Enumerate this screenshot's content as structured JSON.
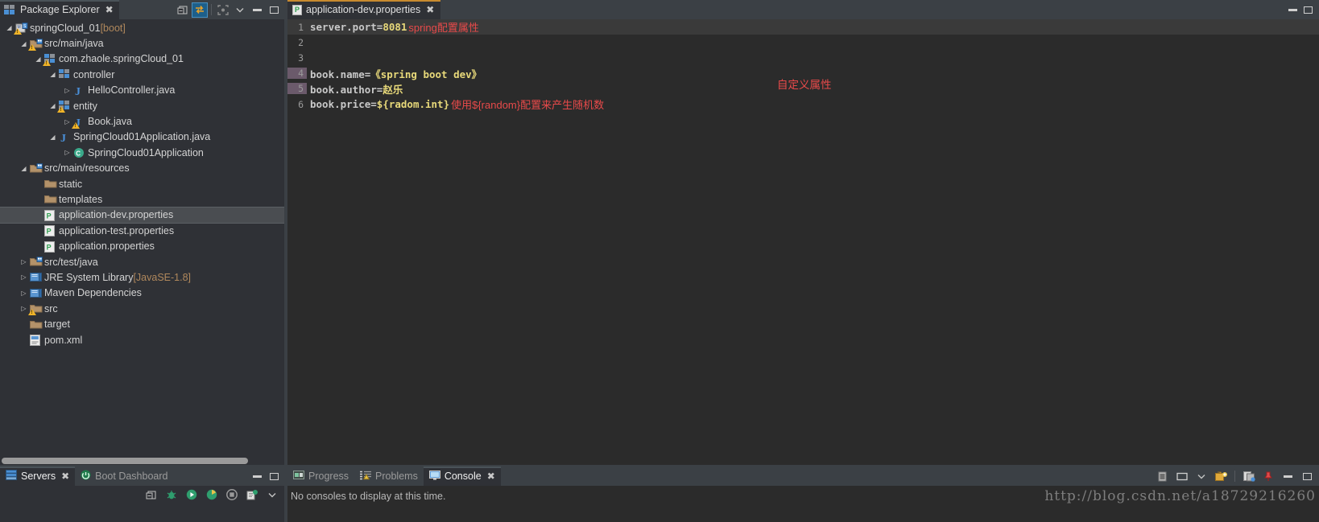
{
  "explorer": {
    "tab_title": "Package Explorer",
    "close_glyph": "✖",
    "toolbar": [
      {
        "name": "collapse-all-icon",
        "glyph": "▣"
      },
      {
        "name": "link-with-editor-icon",
        "glyph": "⇄"
      },
      {
        "name": "focus-on-active-task-icon",
        "glyph": "⛶"
      },
      {
        "name": "view-menu-icon",
        "glyph": "⌄"
      },
      {
        "name": "minimize-icon",
        "glyph": "▬"
      },
      {
        "name": "maximize-icon",
        "glyph": "▭"
      }
    ],
    "tree": [
      {
        "label": "springCloud_01",
        "suffix": " [boot]",
        "indent": 0,
        "arrow": "down",
        "icon": "project",
        "warn": true
      },
      {
        "label": "src/main/java",
        "suffix": "",
        "indent": 1,
        "arrow": "down",
        "icon": "srcfolder",
        "warn": true
      },
      {
        "label": "com.zhaole.springCloud_01",
        "suffix": "",
        "indent": 2,
        "arrow": "down",
        "icon": "package",
        "warn": true
      },
      {
        "label": "controller",
        "suffix": "",
        "indent": 3,
        "arrow": "down",
        "icon": "package",
        "warn": false
      },
      {
        "label": "HelloController.java",
        "suffix": "",
        "indent": 4,
        "arrow": "right",
        "icon": "java",
        "warn": false
      },
      {
        "label": "entity",
        "suffix": "",
        "indent": 3,
        "arrow": "down",
        "icon": "package",
        "warn": true
      },
      {
        "label": "Book.java",
        "suffix": "",
        "indent": 4,
        "arrow": "right",
        "icon": "java",
        "warn": true
      },
      {
        "label": "SpringCloud01Application.java",
        "suffix": "",
        "indent": 3,
        "arrow": "down",
        "icon": "java",
        "warn": false
      },
      {
        "label": "SpringCloud01Application",
        "suffix": "",
        "indent": 4,
        "arrow": "right",
        "icon": "class",
        "warn": false
      },
      {
        "label": "src/main/resources",
        "suffix": "",
        "indent": 1,
        "arrow": "down",
        "icon": "srcfolder",
        "warn": false
      },
      {
        "label": "static",
        "suffix": "",
        "indent": 2,
        "arrow": "none",
        "icon": "folder",
        "warn": false
      },
      {
        "label": "templates",
        "suffix": "",
        "indent": 2,
        "arrow": "none",
        "icon": "folder",
        "warn": false
      },
      {
        "label": "application-dev.properties",
        "suffix": "",
        "indent": 2,
        "arrow": "none",
        "icon": "properties",
        "warn": false,
        "selected": true
      },
      {
        "label": "application-test.properties",
        "suffix": "",
        "indent": 2,
        "arrow": "none",
        "icon": "properties",
        "warn": false
      },
      {
        "label": "application.properties",
        "suffix": "",
        "indent": 2,
        "arrow": "none",
        "icon": "properties",
        "warn": false
      },
      {
        "label": "src/test/java",
        "suffix": "",
        "indent": 1,
        "arrow": "right",
        "icon": "srcfolder",
        "warn": false
      },
      {
        "label": "JRE System Library",
        "suffix": " [JavaSE-1.8]",
        "indent": 1,
        "arrow": "right",
        "icon": "library",
        "warn": false
      },
      {
        "label": "Maven Dependencies",
        "suffix": "",
        "indent": 1,
        "arrow": "right",
        "icon": "library",
        "warn": false
      },
      {
        "label": "src",
        "suffix": "",
        "indent": 1,
        "arrow": "right",
        "icon": "folder",
        "warn": true
      },
      {
        "label": "target",
        "suffix": "",
        "indent": 1,
        "arrow": "none",
        "icon": "folder",
        "warn": false
      },
      {
        "label": "pom.xml",
        "suffix": "",
        "indent": 1,
        "arrow": "none",
        "icon": "xml",
        "warn": false
      }
    ]
  },
  "editor": {
    "tab_title": "application-dev.properties",
    "close_glyph": "✖",
    "minimize_glyph": "▬",
    "maximize_glyph": "▭",
    "lines": [
      {
        "num": "1",
        "key": "server.port=",
        "value": "8081",
        "annotation": "spring配置属性",
        "changed": false,
        "current": true
      },
      {
        "num": "2",
        "key": "",
        "value": "",
        "annotation": "",
        "changed": false,
        "current": false
      },
      {
        "num": "3",
        "key": "",
        "value": "",
        "annotation": "",
        "changed": false,
        "current": false
      },
      {
        "num": "4",
        "key": "book.name=",
        "value": "《spring boot dev》",
        "annotation": "",
        "changed": true,
        "current": false
      },
      {
        "num": "5",
        "key": "book.author=",
        "value": "赵乐",
        "annotation": "",
        "changed": true,
        "current": false
      },
      {
        "num": "6",
        "key": "book.price=",
        "value": "${radom.int}",
        "annotation": "使用${random}配置来产生随机数",
        "changed": false,
        "current": false
      }
    ],
    "float_annotation": "自定义属性"
  },
  "servers_panel": {
    "tabs": [
      {
        "label": "Servers",
        "active": true,
        "icon": "servers-icon",
        "close_glyph": "✖"
      },
      {
        "label": "Boot Dashboard",
        "active": false,
        "icon": "boot-dashboard-icon",
        "close_glyph": ""
      }
    ],
    "minimize_glyph": "▬",
    "maximize_glyph": "▭",
    "toolbar": [
      {
        "name": "collapse-all-icon",
        "glyph": "▣"
      },
      {
        "name": "debug-icon",
        "glyph": "☢"
      },
      {
        "name": "start-icon",
        "glyph": "▶"
      },
      {
        "name": "profile-icon",
        "glyph": "◕"
      },
      {
        "name": "stop-icon",
        "glyph": "◉"
      },
      {
        "name": "publish-icon",
        "glyph": "▤"
      },
      {
        "name": "view-menu-icon",
        "glyph": "⌄"
      }
    ]
  },
  "console_panel": {
    "tabs": [
      {
        "label": "Progress",
        "active": false,
        "icon": "progress-icon",
        "close_glyph": ""
      },
      {
        "label": "Problems",
        "active": false,
        "icon": "problems-icon",
        "close_glyph": ""
      },
      {
        "label": "Console",
        "active": true,
        "icon": "console-icon",
        "close_glyph": "✖"
      }
    ],
    "status_text": "No consoles to display at this time.",
    "toolbar": [
      {
        "name": "clear-console-icon",
        "glyph": "▤"
      },
      {
        "name": "scroll-lock-icon",
        "glyph": "▭"
      },
      {
        "name": "display-selected-console-icon",
        "glyph": "⌄"
      },
      {
        "name": "open-console-icon",
        "glyph": "▣"
      },
      {
        "name": "pin-console-icon",
        "glyph": "📌"
      },
      {
        "name": "new-console-view-icon",
        "glyph": "❐"
      },
      {
        "name": "minimize-icon",
        "glyph": "▬"
      },
      {
        "name": "maximize-icon",
        "glyph": "▭"
      }
    ]
  },
  "watermark": {
    "text": "http://blog.csdn.net/a18729216260"
  }
}
